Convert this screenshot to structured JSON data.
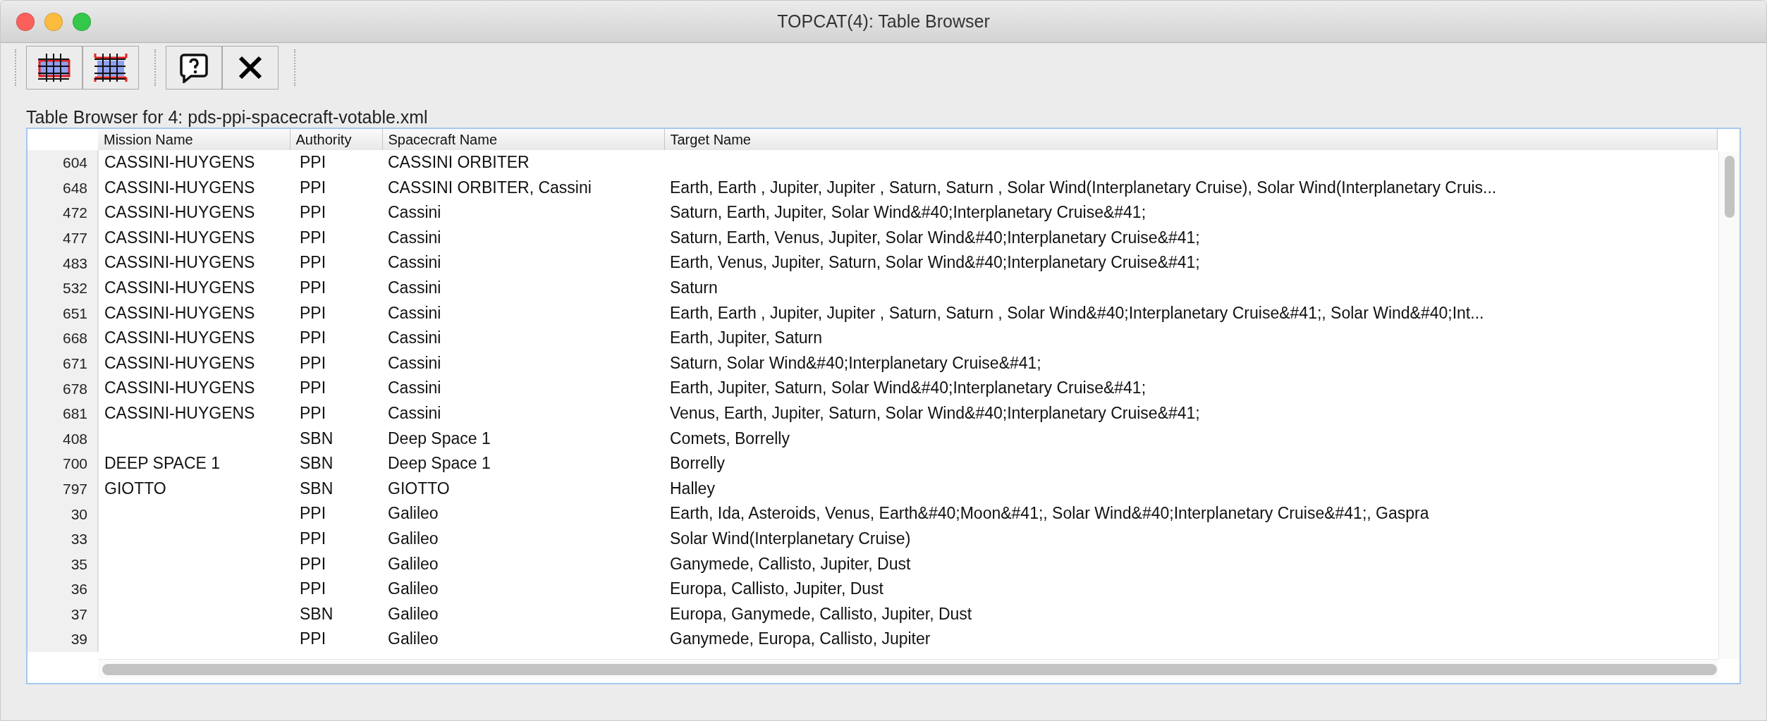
{
  "window": {
    "title": "TOPCAT(4): Table Browser"
  },
  "toolbar": {
    "groups": [
      [
        {
          "kind": "rows"
        },
        {
          "kind": "columns"
        }
      ],
      [
        {
          "kind": "help"
        },
        {
          "kind": "close"
        }
      ]
    ]
  },
  "browser_label": "Table Browser for 4: pds-ppi-spacecraft-votable.xml",
  "table": {
    "columns": [
      "Mission Name",
      "Authority",
      "Spacecraft Name",
      "Target Name"
    ],
    "rows": [
      {
        "index": "604",
        "cells": [
          "CASSINI-HUYGENS",
          "PPI",
          "CASSINI ORBITER",
          ""
        ]
      },
      {
        "index": "648",
        "cells": [
          "CASSINI-HUYGENS",
          "PPI",
          "CASSINI ORBITER, Cassini",
          "Earth, Earth , Jupiter, Jupiter , Saturn, Saturn , Solar Wind(Interplanetary Cruise), Solar Wind(Interplanetary Cruis..."
        ]
      },
      {
        "index": "472",
        "cells": [
          "CASSINI-HUYGENS",
          "PPI",
          "Cassini",
          "Saturn, Earth, Jupiter, Solar Wind&#40;Interplanetary Cruise&#41;"
        ]
      },
      {
        "index": "477",
        "cells": [
          "CASSINI-HUYGENS",
          "PPI",
          "Cassini",
          "Saturn, Earth, Venus, Jupiter, Solar Wind&#40;Interplanetary Cruise&#41;"
        ]
      },
      {
        "index": "483",
        "cells": [
          "CASSINI-HUYGENS",
          "PPI",
          "Cassini",
          "Earth, Venus, Jupiter, Saturn, Solar Wind&#40;Interplanetary Cruise&#41;"
        ]
      },
      {
        "index": "532",
        "cells": [
          "CASSINI-HUYGENS",
          "PPI",
          "Cassini",
          "Saturn"
        ]
      },
      {
        "index": "651",
        "cells": [
          "CASSINI-HUYGENS",
          "PPI",
          "Cassini",
          "Earth, Earth , Jupiter, Jupiter , Saturn, Saturn , Solar Wind&#40;Interplanetary Cruise&#41;, Solar Wind&#40;Int..."
        ]
      },
      {
        "index": "668",
        "cells": [
          "CASSINI-HUYGENS",
          "PPI",
          "Cassini",
          "Earth, Jupiter, Saturn"
        ]
      },
      {
        "index": "671",
        "cells": [
          "CASSINI-HUYGENS",
          "PPI",
          "Cassini",
          "Saturn, Solar Wind&#40;Interplanetary Cruise&#41;"
        ]
      },
      {
        "index": "678",
        "cells": [
          "CASSINI-HUYGENS",
          "PPI",
          "Cassini",
          "Earth, Jupiter, Saturn, Solar Wind&#40;Interplanetary Cruise&#41;"
        ]
      },
      {
        "index": "681",
        "cells": [
          "CASSINI-HUYGENS",
          "PPI",
          "Cassini",
          "Venus, Earth, Jupiter, Saturn, Solar Wind&#40;Interplanetary Cruise&#41;"
        ]
      },
      {
        "index": "408",
        "cells": [
          "",
          "SBN",
          "Deep Space 1",
          "Comets, Borrelly"
        ]
      },
      {
        "index": "700",
        "cells": [
          "DEEP SPACE 1",
          "SBN",
          "Deep Space 1",
          "Borrelly"
        ]
      },
      {
        "index": "797",
        "cells": [
          "GIOTTO",
          "SBN",
          "GIOTTO",
          "Halley"
        ]
      },
      {
        "index": "30",
        "cells": [
          "",
          "PPI",
          "Galileo",
          "Earth, Ida, Asteroids, Venus, Earth&#40;Moon&#41;, Solar Wind&#40;Interplanetary Cruise&#41;, Gaspra"
        ]
      },
      {
        "index": "33",
        "cells": [
          "",
          "PPI",
          "Galileo",
          "Solar Wind(Interplanetary Cruise)"
        ]
      },
      {
        "index": "35",
        "cells": [
          "",
          "PPI",
          "Galileo",
          "Ganymede, Callisto, Jupiter, Dust"
        ]
      },
      {
        "index": "36",
        "cells": [
          "",
          "PPI",
          "Galileo",
          "Europa, Callisto, Jupiter, Dust"
        ]
      },
      {
        "index": "37",
        "cells": [
          "",
          "SBN",
          "Galileo",
          "Europa, Ganymede, Callisto, Jupiter, Dust"
        ]
      },
      {
        "index": "39",
        "cells": [
          "",
          "PPI",
          "Galileo",
          "Ganymede, Europa, Callisto, Jupiter"
        ]
      }
    ]
  }
}
